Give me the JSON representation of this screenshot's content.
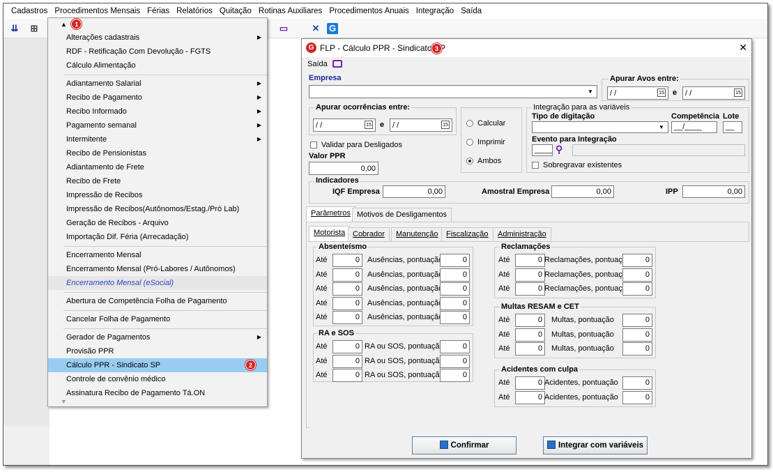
{
  "menubar": [
    "Cadastros",
    "Procedimentos Mensais",
    "Férias",
    "Relatórios",
    "Quitação",
    "Rotinas Auxiliares",
    "Procedimentos Anuais",
    "Integração",
    "Saída"
  ],
  "dropdown": {
    "badge1": "1",
    "badge2": "2",
    "items": [
      {
        "label": "Alterações cadastrais",
        "sub": true
      },
      {
        "label": "RDF - Retificação Com Devolução - FGTS"
      },
      {
        "label": "Cálculo Alimentação"
      },
      {
        "sep": true
      },
      {
        "label": "Adiantamento Salarial",
        "sub": true
      },
      {
        "label": "Recibo de Pagamento",
        "sub": true
      },
      {
        "label": "Recibo Informado",
        "sub": true
      },
      {
        "label": "Pagamento semanal",
        "sub": true
      },
      {
        "label": "Intermitente",
        "sub": true
      },
      {
        "label": "Recibo de Pensionistas"
      },
      {
        "label": "Adiantamento de Frete"
      },
      {
        "label": "Recibo de Frete"
      },
      {
        "label": "Impressão de Recibos"
      },
      {
        "label": "Impressão de Recibos(Autônomos/Estag./Pró Lab)"
      },
      {
        "label": "Geração de Recibos - Arquivo"
      },
      {
        "label": "Importação Dif. Féria (Arrecadação)"
      },
      {
        "sep": true
      },
      {
        "label": "Encerramento Mensal"
      },
      {
        "label": "Encerramento Mensal (Pró-Labores / Autônomos)"
      },
      {
        "label": "Encerramento Mensal (eSocial)",
        "italic": true
      },
      {
        "sep": true
      },
      {
        "label": "Abertura de Competência Folha de Pagamento"
      },
      {
        "sep": true
      },
      {
        "label": "Cancelar Folha de Pagamento"
      },
      {
        "sep": true
      },
      {
        "label": "Gerador de Pagamentos",
        "sub": true
      },
      {
        "label": "Provisão PPR"
      },
      {
        "label": "Cálculo PPR - Sindicato SP",
        "selected": true
      },
      {
        "label": "Controle de convênio médico"
      },
      {
        "label": "Assinatura Recibo de Pagamento Tá.ON"
      }
    ]
  },
  "dialog": {
    "title": "FLP - Cálculo PPR - Sindicato SP",
    "badge3": "3",
    "close": "✕",
    "saida": "Saída",
    "empresa_label": "Empresa",
    "apurar_avos": "Apurar Avos entre:",
    "date_placeholder": "/ /",
    "e": "e",
    "apurar_ocorrencias": "Apurar ocorrências entre:",
    "radios": [
      {
        "label": "Calcular",
        "checked": false
      },
      {
        "label": "Imprimir",
        "checked": false
      },
      {
        "label": "Ambos",
        "checked": true
      }
    ],
    "integracao_group": "Integração para as variáveis",
    "tipo_digitacao": "Tipo de digitação",
    "competencia": "Competência",
    "competencia_value": "__/____",
    "lote": "Lote",
    "lote_value": "__",
    "evento_integracao": "Evento para Integração",
    "evento_value": "_____",
    "sobregravar": "Sobregravar existentes",
    "validar_desligados": "Validar para Desligados",
    "valor_ppr": "Valor PPR",
    "valor_ppr_value": "0,00",
    "indicadores": "Indicadores",
    "iqf_empresa": "IQF Empresa",
    "iqf_value": "0,00",
    "amostral_empresa": "Amostral Empresa",
    "amostral_value": "0,00",
    "ipp": "IPP",
    "ipp_value": "0,00",
    "tabs_outer": [
      "Parâmetros",
      "Motivos de Desligamentos"
    ],
    "tabs_inner": [
      "Motorista",
      "Cobrador",
      "Manutenção",
      "Fiscalização",
      "Administração"
    ],
    "ate": "Até",
    "zero": "0",
    "absenteismo": "Absenteísmo",
    "ausencias": "Ausências, pontuação",
    "ra_sos": "RA e SOS",
    "ra_sos_label": "RA ou SOS, pontuação",
    "reclamacoes": "Reclamações",
    "reclamacoes_label": "Reclamações, pontuação",
    "multas": "Multas RESAM e CET",
    "multas_label": "Multas, pontuação",
    "acidentes": "Acidentes com culpa",
    "acidentes_label": "Acidentes, pontuação",
    "btn_confirmar": "Confirmar",
    "btn_integrar": "Integrar com variáveis"
  }
}
